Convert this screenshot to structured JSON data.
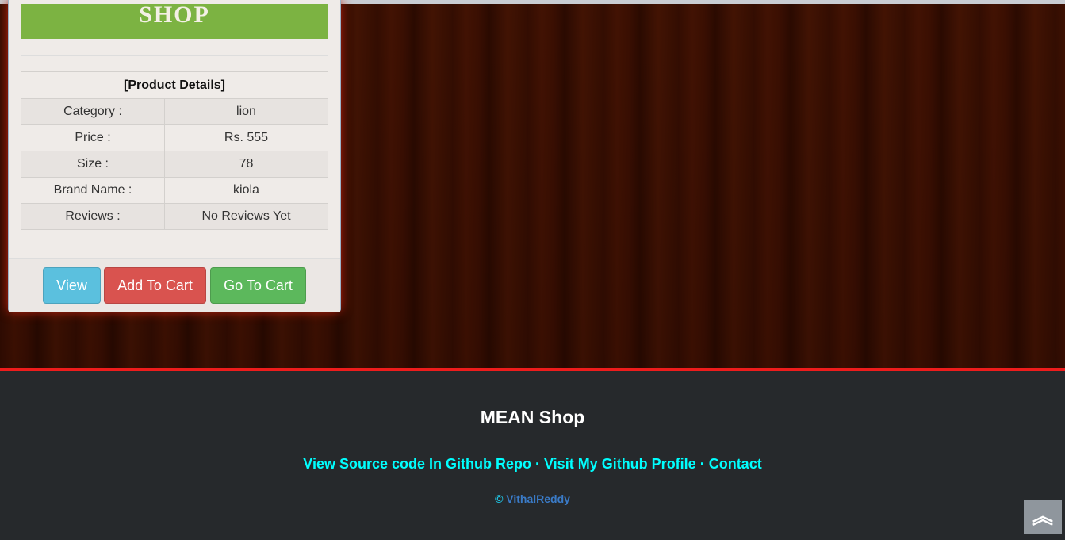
{
  "banner": {
    "text": "SHOP"
  },
  "product": {
    "header": "[Product Details]",
    "rows": [
      {
        "label": "Category :",
        "value": "lion"
      },
      {
        "label": "Price :",
        "value": "Rs. 555"
      },
      {
        "label": "Size :",
        "value": "78"
      },
      {
        "label": "Brand Name :",
        "value": "kiola"
      },
      {
        "label": "Reviews :",
        "value": "No Reviews Yet"
      }
    ]
  },
  "buttons": {
    "view": "View",
    "add": "Add To Cart",
    "go": "Go To Cart"
  },
  "footer": {
    "title": "MEAN Shop",
    "link1": "View Source code In Github Repo",
    "sep": " · ",
    "link2": "Visit My Github Profile",
    "link3": "Contact",
    "copy_symbol": "©",
    "author": "VithalReddy"
  },
  "scroll_top": {
    "icon": "double-chevron-up-icon"
  }
}
